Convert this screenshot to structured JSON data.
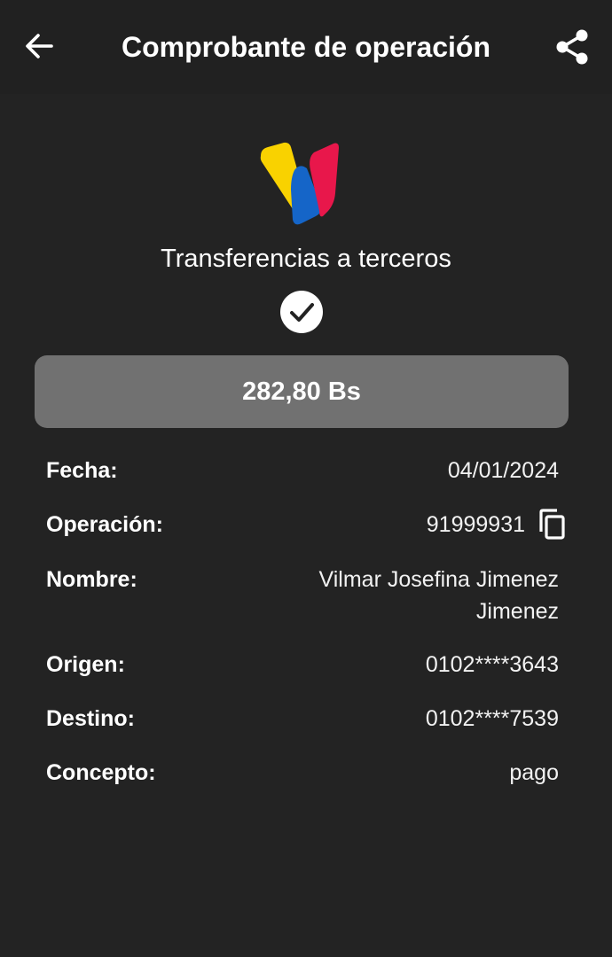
{
  "header": {
    "title": "Comprobante de operación",
    "back_icon": "arrow-left-icon",
    "share_icon": "share-icon"
  },
  "logo": {
    "name": "bank-logo",
    "colors": [
      "#F9D200",
      "#1565C8",
      "#E8174B"
    ]
  },
  "transaction": {
    "type": "Transferencias a terceros",
    "status_icon": "check-circle-icon",
    "amount": "282,80 Bs"
  },
  "details": {
    "fecha_label": "Fecha:",
    "fecha_value": "04/01/2024",
    "operacion_label": "Operación:",
    "operacion_value": "91999931",
    "copy_icon": "copy-icon",
    "nombre_label": "Nombre:",
    "nombre_value": "Vilmar Josefina Jimenez Jimenez",
    "origen_label": "Origen:",
    "origen_value": "0102****3643",
    "destino_label": "Destino:",
    "destino_value": "0102****7539",
    "concepto_label": "Concepto:",
    "concepto_value": "pago"
  },
  "colors": {
    "background": "#232323",
    "amount_box": "#717171",
    "text": "#FFFFFF"
  }
}
